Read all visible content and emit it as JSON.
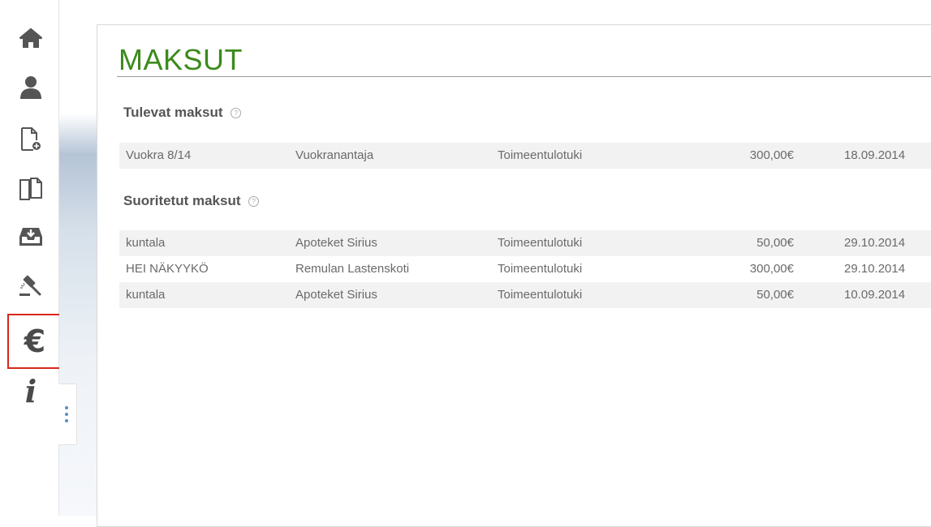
{
  "nav": {
    "items": [
      {
        "icon": "home-icon"
      },
      {
        "icon": "user-icon"
      },
      {
        "icon": "new-document-icon"
      },
      {
        "icon": "documents-icon"
      },
      {
        "icon": "inbox-download-icon"
      },
      {
        "icon": "gavel-icon"
      },
      {
        "icon": "euro-icon",
        "selected": true,
        "symbol": "€"
      },
      {
        "icon": "info-icon",
        "symbol": "i"
      }
    ],
    "selected_outline_color": "#d9261c"
  },
  "page": {
    "title": "MAKSUT",
    "title_color": "#3c8a1c"
  },
  "upcoming": {
    "heading": "Tulevat maksut",
    "help_symbol": "?",
    "rows": [
      {
        "description": "Vuokra 8/14",
        "payee": "Vuokranantaja",
        "type": "Toimeentulotuki",
        "amount": "300,00€",
        "date": "18.09.2014"
      }
    ]
  },
  "completed": {
    "heading": "Suoritetut maksut",
    "help_symbol": "?",
    "rows": [
      {
        "description": "kuntala",
        "payee": "Apoteket Sirius",
        "type": "Toimeentulotuki",
        "amount": "50,00€",
        "date": "29.10.2014"
      },
      {
        "description": "HEI NÄKYYKÖ",
        "payee": "Remulan Lastenskoti",
        "type": "Toimeentulotuki",
        "amount": "300,00€",
        "date": "29.10.2014"
      },
      {
        "description": "kuntala",
        "payee": "Apoteket Sirius",
        "type": "Toimeentulotuki",
        "amount": "50,00€",
        "date": "10.09.2014"
      }
    ]
  }
}
